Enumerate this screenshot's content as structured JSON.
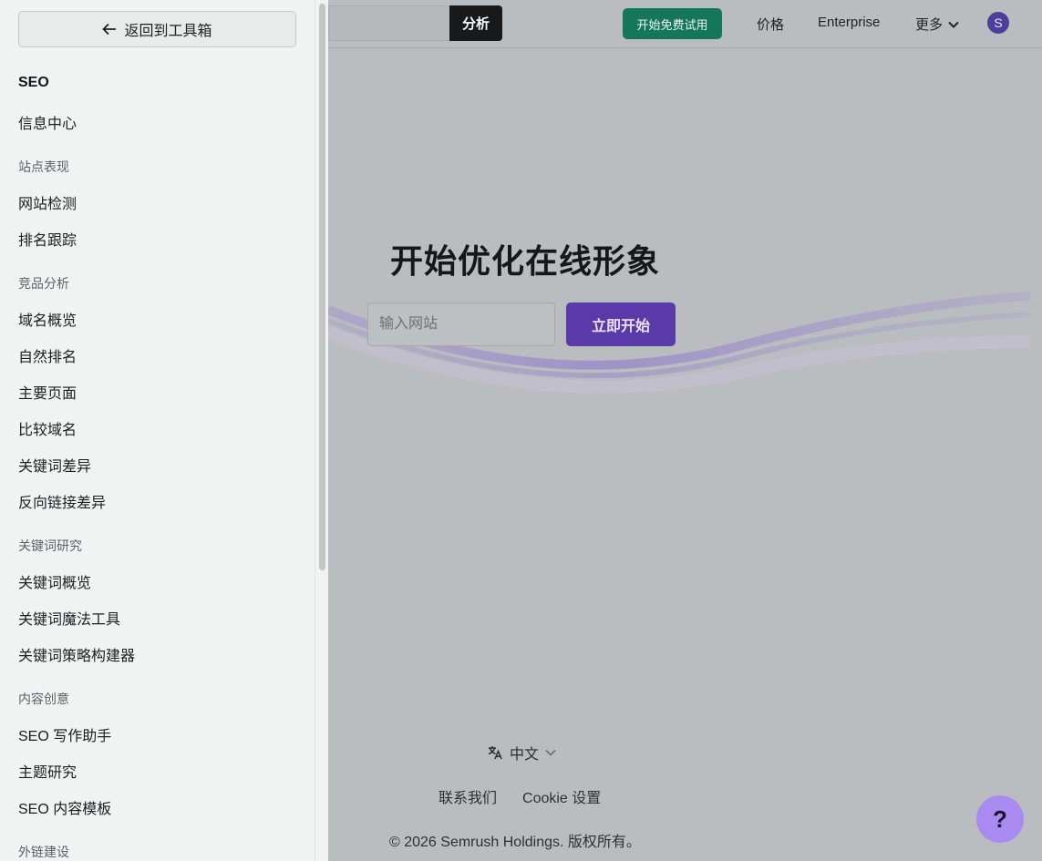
{
  "header": {
    "analyze_label": "分析",
    "trial_label": "开始免费试用",
    "nav": {
      "price": "价格",
      "enterprise": "Enterprise",
      "more": "更多"
    },
    "avatar_letter": "S"
  },
  "hero": {
    "title": "开始优化在线形象",
    "input_placeholder": "输入网站",
    "start_label": "立即开始"
  },
  "footer": {
    "language": "中文",
    "contact": "联系我们",
    "cookie": "Cookie 设置",
    "copyright": "© 2026 Semrush Holdings. 版权所有。"
  },
  "help": {
    "label": "?"
  },
  "sidebar": {
    "back_label": "返回到工具箱",
    "heading": "SEO",
    "info_center": "信息中心",
    "sections": [
      {
        "title": "站点表现",
        "items": [
          "网站检测",
          "排名跟踪"
        ]
      },
      {
        "title": "竞品分析",
        "items": [
          "域名概览",
          "自然排名",
          "主要页面",
          "比较域名",
          "关键词差异",
          "反向链接差异"
        ]
      },
      {
        "title": "关键词研究",
        "items": [
          "关键词概览",
          "关键词魔法工具",
          "关键词策略构建器"
        ]
      },
      {
        "title": "内容创意",
        "items": [
          "SEO 写作助手",
          "主题研究",
          "SEO 内容模板"
        ]
      },
      {
        "title": "外链建设",
        "items": []
      }
    ]
  },
  "colors": {
    "analyze_bg": "#17191b",
    "trial_bg": "#15775a",
    "start_bg": "#5a3aa8",
    "help_bg": "#a98af0",
    "sidebar_bg": "#f1f3f2",
    "overlay_bg": "#b9bdbf"
  }
}
